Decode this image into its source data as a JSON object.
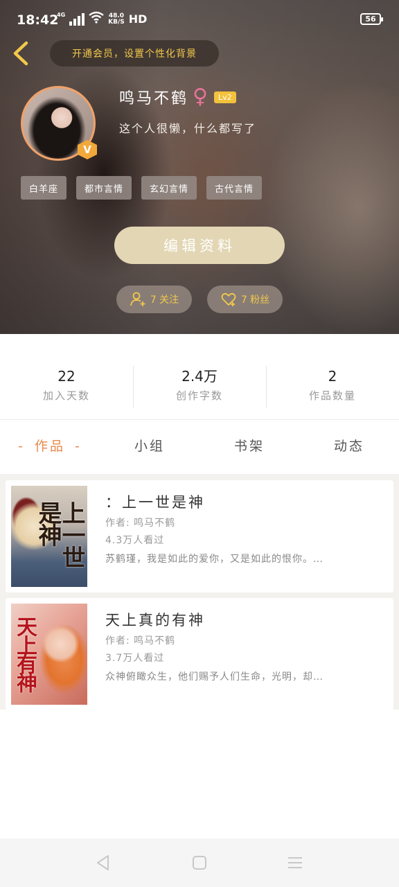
{
  "status_bar": {
    "time": "18:42",
    "network": "4G",
    "speed_value": "48.0",
    "speed_unit": "KB/S",
    "hd": "HD",
    "battery": "56"
  },
  "header": {
    "vip_banner": "开通会员，设置个性化背景",
    "user": {
      "name": "鸣马不鹤",
      "gender_icon": "female-icon",
      "level": "Lv2",
      "bio": "这个人很懒，什么都写了",
      "verified_badge": "V"
    },
    "tags": [
      "白羊座",
      "都市言情",
      "玄幻言情",
      "古代言情"
    ],
    "edit_button": "编辑资料",
    "following_label": "7 关注",
    "fans_label": "7 粉丝",
    "colors": {
      "accent_gold": "#f2c94c",
      "avatar_ring": "#f0a26a",
      "edit_button_bg": "#e2d6b4"
    }
  },
  "stats": [
    {
      "value": "22",
      "label": "加入天数"
    },
    {
      "value": "2.4万",
      "label": "创作字数"
    },
    {
      "value": "2",
      "label": "作品数量"
    }
  ],
  "tabs": [
    {
      "label": "作品",
      "active": true
    },
    {
      "label": "小组",
      "active": false
    },
    {
      "label": "书架",
      "active": false
    },
    {
      "label": "动态",
      "active": false
    }
  ],
  "tab_active_color": "#e8894a",
  "books": [
    {
      "title": "：上一世是神",
      "cover_text": "上一世是神",
      "author": "作者: 鸣马不鹤",
      "readers": "4.3万人看过",
      "description": "苏鹤瑾，我是如此的爱你，又是如此的恨你。…"
    },
    {
      "title": "天上真的有神",
      "cover_text": "天上有神",
      "author": "作者: 鸣马不鹤",
      "readers": "3.7万人看过",
      "description": "众神俯瞰众生，他们赐予人们生命，光明，却…"
    }
  ],
  "navbar": {
    "icons": [
      "back-triangle-icon",
      "home-square-icon",
      "menu-lines-icon"
    ]
  }
}
